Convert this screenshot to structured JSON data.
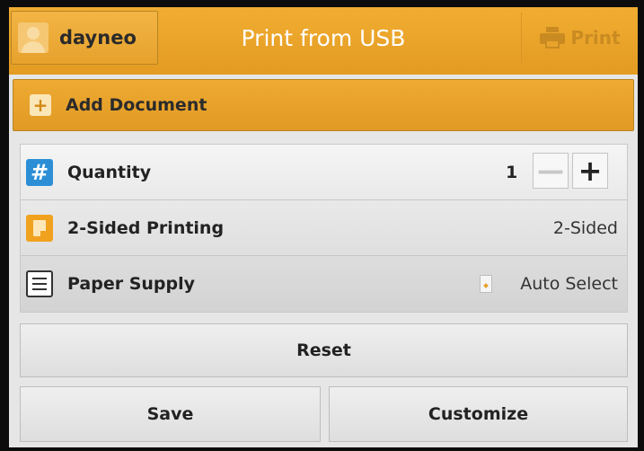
{
  "header": {
    "user_name": "dayneo",
    "title": "Print from USB",
    "print_label": "Print"
  },
  "add_document": {
    "label": "Add Document"
  },
  "settings": {
    "quantity": {
      "label": "Quantity",
      "value": "1",
      "minus": "—",
      "plus": "+"
    },
    "two_sided": {
      "label": "2-Sided Printing",
      "value": "2-Sided"
    },
    "paper_supply": {
      "label": "Paper Supply",
      "value": "Auto Select"
    }
  },
  "actions": {
    "reset": "Reset",
    "save": "Save",
    "customize": "Customize"
  },
  "colors": {
    "header_orange": "#e39b22",
    "quantity_icon_blue": "#2c8fd6",
    "two_sided_icon_orange": "#f0a21f"
  },
  "icons": {
    "user": "user-avatar-icon",
    "print": "printer-icon",
    "add": "plus-icon",
    "quantity": "hash-icon",
    "two_sided": "document-icon",
    "paper_supply": "tray-icon",
    "paper_size": "paper-icon"
  }
}
